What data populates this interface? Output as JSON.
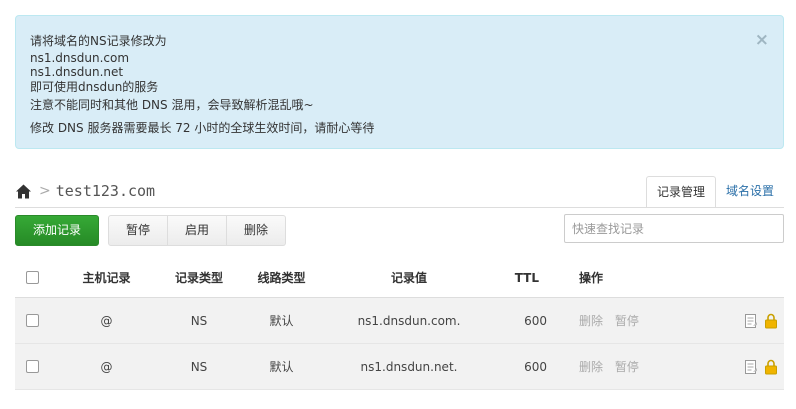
{
  "notice": {
    "line1": "请将域名的NS记录修改为",
    "line2": "ns1.dnsdun.com",
    "line3": "ns1.dnsdun.net",
    "line4": "即可使用dnsdun的服务",
    "line5": "注意不能同时和其他 DNS 混用，会导致解析混乱哦~",
    "line6": "修改 DNS 服务器需要最长 72 小时的全球生效时间，请耐心等待",
    "close": "×"
  },
  "breadcrumb": {
    "separator": ">",
    "domain": "test123.com"
  },
  "tabs": [
    {
      "label": "记录管理",
      "active": true
    },
    {
      "label": "域名设置",
      "active": false
    }
  ],
  "toolbar": {
    "add_label": "添加记录",
    "pause_label": "暂停",
    "enable_label": "启用",
    "delete_label": "删除",
    "search_placeholder": "快速查找记录"
  },
  "table": {
    "headers": {
      "host": "主机记录",
      "type": "记录类型",
      "line": "线路类型",
      "value": "记录值",
      "ttl": "TTL",
      "ops": "操作"
    },
    "rows": [
      {
        "host": "@",
        "type": "NS",
        "line": "默认",
        "value": "ns1.dnsdun.com.",
        "ttl": "600",
        "op_delete": "删除",
        "op_pause": "暂停"
      },
      {
        "host": "@",
        "type": "NS",
        "line": "默认",
        "value": "ns1.dnsdun.net.",
        "ttl": "600",
        "op_delete": "删除",
        "op_pause": "暂停"
      }
    ]
  },
  "colors": {
    "alert_bg": "#d9edf7",
    "add_button": "#2d9a2d",
    "tab_link": "#2a6fa8",
    "lock": "#f0b400"
  },
  "icons": {
    "home": "home-icon",
    "note": "note-icon",
    "lock": "lock-icon"
  }
}
